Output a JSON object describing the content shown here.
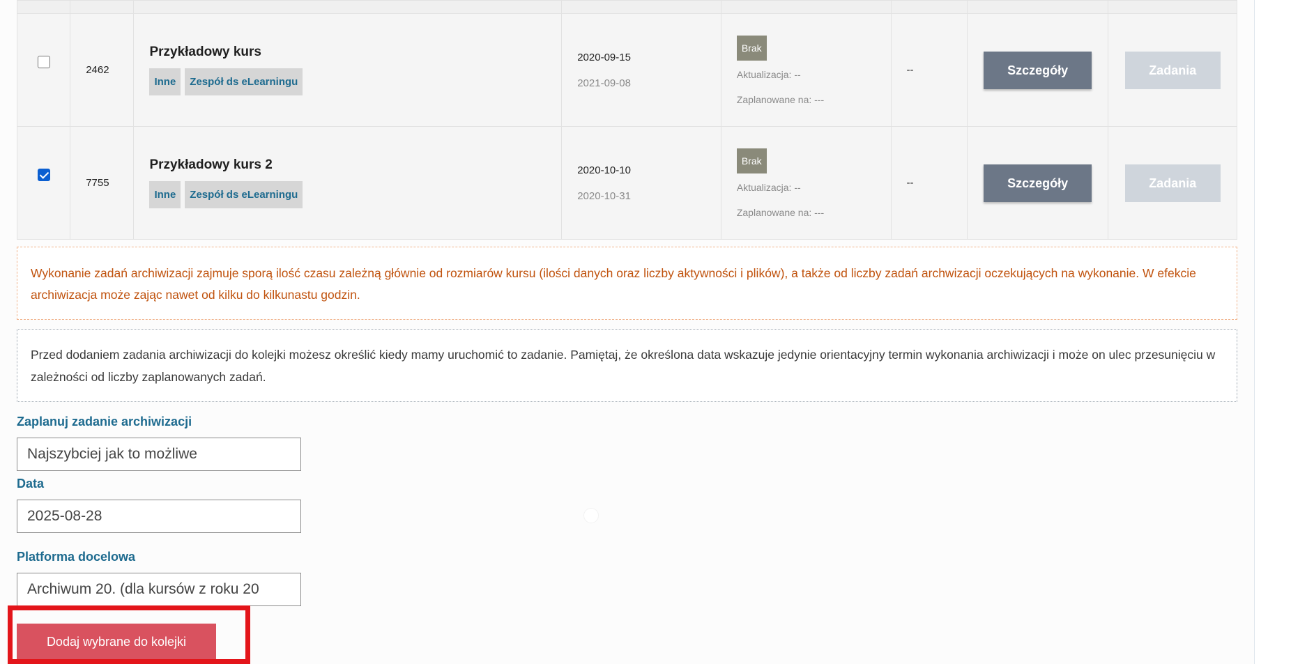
{
  "courses": [
    {
      "checked": false,
      "id": "2462",
      "name": "Przykładowy kurs",
      "tags": [
        "Inne",
        "Zespół ds eLearningu"
      ],
      "date_start": "2020-09-15",
      "date_end": "2021-09-08",
      "badge": "Brak",
      "update_text": "Aktualizacja: --",
      "planned_text": "Zaplanowane na: ---",
      "extra": "--",
      "details_label": "Szczegóły",
      "tasks_label": "Zadania"
    },
    {
      "checked": true,
      "id": "7755",
      "name": "Przykładowy kurs 2",
      "tags": [
        "Inne",
        "Zespół ds eLearningu"
      ],
      "date_start": "2020-10-10",
      "date_end": "2020-10-31",
      "badge": "Brak",
      "update_text": "Aktualizacja: --",
      "planned_text": "Zaplanowane na: ---",
      "extra": "--",
      "details_label": "Szczegóły",
      "tasks_label": "Zadania"
    }
  ],
  "notices": {
    "warning": "Wykonanie zadań archiwizacji zajmuje sporą ilość czasu zależną głównie od rozmiarów kursu (ilości danych oraz liczby aktywności i plików), a także od liczby zadań archwizacji oczekujących na wykonanie. W efekcie archiwizacja może zając nawet od kilku do kilkunastu godzin.",
    "info": "Przed dodaniem zadania archiwizacji do kolejki możesz określić kiedy mamy uruchomić to zadanie. Pamiętaj, że określona data wskazuje jedynie orientacyjny termin wykonania archiwizacji i może on ulec przesunięciu w zależności od liczby zaplanowanych zadań."
  },
  "form": {
    "schedule_label": "Zaplanuj zadanie archiwizacji",
    "schedule_value": "Najszybciej jak to możliwe",
    "date_label": "Data",
    "date_value": "2025-08-28",
    "platform_label": "Platforma docelowa",
    "platform_value": "Archiwum 20.  (dla kursów z roku 20",
    "submit_label": "Dodaj wybrane do kolejki"
  },
  "colors": {
    "accent_blue": "#1e6b8f",
    "warning_orange": "#c0520d",
    "submit_red": "#d9525f",
    "highlight_red": "#e3151a"
  }
}
